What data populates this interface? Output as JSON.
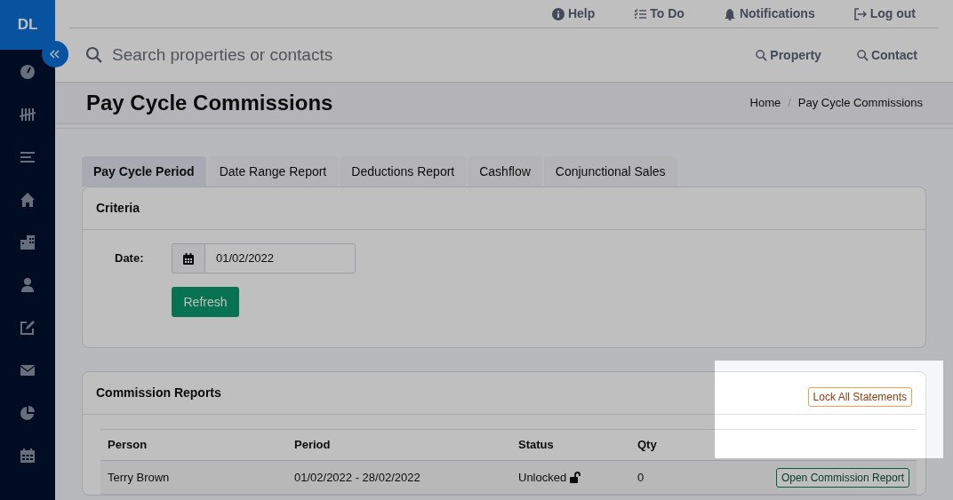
{
  "logo": "DL",
  "top_links": [
    "Help",
    "To Do",
    "Notifications",
    "Log out"
  ],
  "search": {
    "placeholder": "Search properties or contacts"
  },
  "search_links": [
    "Property",
    "Contact"
  ],
  "page_title": "Pay Cycle Commissions",
  "breadcrumb": [
    "Home",
    "Pay Cycle Commissions"
  ],
  "breadcrumb_separator": "/",
  "tabs": [
    {
      "label": "Pay Cycle Period",
      "selected": true
    },
    {
      "label": "Date Range Report",
      "selected": false
    },
    {
      "label": "Deductions Report",
      "selected": false
    },
    {
      "label": "Cashflow",
      "selected": false
    },
    {
      "label": "Conjunctional Sales",
      "selected": false
    }
  ],
  "criteria": {
    "title": "Criteria",
    "date_label": "Date:",
    "date_value": "01/02/2022",
    "button": "Refresh"
  },
  "reports": {
    "title": "Commission Reports",
    "lock_all_button": "Lock All Statements",
    "columns": [
      "Person",
      "Period",
      "Status",
      "Qty"
    ],
    "rows": [
      {
        "person": "Terry Brown",
        "period": "01/02/2022 - 28/02/2022",
        "status": "Unlocked",
        "locked": false,
        "qty": "0",
        "action": "Open Commission Report"
      }
    ]
  }
}
